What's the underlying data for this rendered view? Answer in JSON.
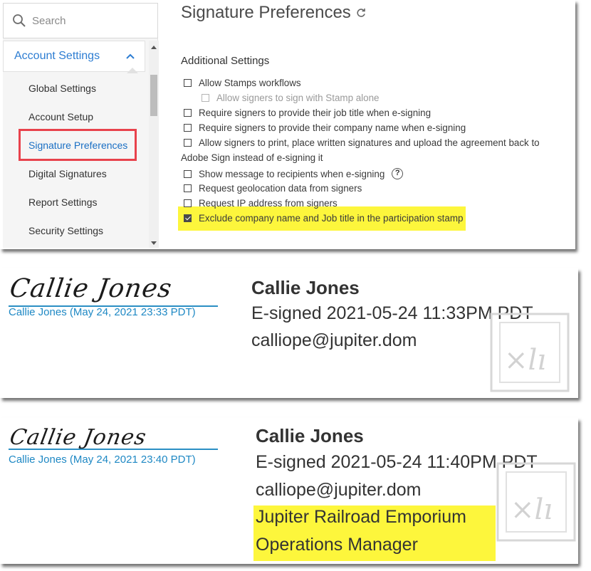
{
  "sidebar": {
    "search_placeholder": "Search",
    "section_label": "Account Settings",
    "items": [
      {
        "label": "Global Settings"
      },
      {
        "label": "Account Setup"
      },
      {
        "label": "Signature Preferences",
        "active": true
      },
      {
        "label": "Digital Signatures"
      },
      {
        "label": "Report Settings"
      },
      {
        "label": "Security Settings"
      }
    ]
  },
  "main": {
    "title": "Signature Preferences",
    "section_title": "Additional Settings",
    "options": [
      {
        "label": "Allow Stamps workflows",
        "checked": false
      },
      {
        "label": "Allow signers to sign with Stamp alone",
        "checked": false,
        "disabled": true
      },
      {
        "label": "Require signers to provide their job title when e-signing",
        "checked": false
      },
      {
        "label": "Require signers to provide their company name when e-signing",
        "checked": false
      },
      {
        "label": "Allow signers to print, place written signatures and upload the agreement back to",
        "checked": false
      },
      {
        "label": "Adobe Sign instead of e-signing it"
      },
      {
        "label": "Show message to recipients when e-signing",
        "checked": false
      },
      {
        "label": "Request geolocation data from signers",
        "checked": false
      },
      {
        "label": "Request IP address from signers",
        "checked": false
      },
      {
        "label": "Exclude company name and Job title in the participation stamp",
        "checked": true
      }
    ],
    "help_glyph": "?"
  },
  "stamps": [
    {
      "signature_script": "Callie Jones",
      "caption": "Callie Jones (May 24, 2021 23:33 PDT)",
      "name": "Callie Jones",
      "esigned": "E-signed 2021-05-24 11:33PM PDT",
      "email": "calliope@jupiter.dom"
    },
    {
      "signature_script": "Callie Jones",
      "caption": "Callie Jones (May 24, 2021 23:40 PDT)",
      "name": "Callie Jones",
      "esigned": "E-signed 2021-05-24 11:40PM PDT",
      "email": "calliope@jupiter.dom",
      "company": "Jupiter Railroad Emporium",
      "job_title": "Operations Manager"
    }
  ],
  "colors": {
    "link_blue": "#2d7dd2",
    "highlight_red": "#e8424c",
    "highlight_yellow": "#fdf63c",
    "signature_line": "#2b8fc4"
  },
  "icons": [
    "search-icon",
    "chevron-up-icon",
    "refresh-icon",
    "help-icon",
    "checkbox-checked-icon",
    "adobe-sign-stamp-icon"
  ]
}
